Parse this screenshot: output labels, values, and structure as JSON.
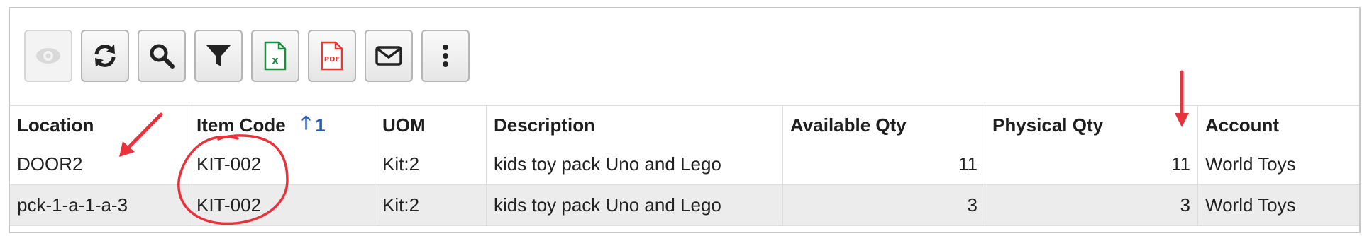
{
  "toolbar": {
    "buttons": [
      {
        "icon": "eye-icon",
        "enabled": false
      },
      {
        "icon": "refresh-icon",
        "enabled": true
      },
      {
        "icon": "search-icon",
        "enabled": true
      },
      {
        "icon": "filter-icon",
        "enabled": true
      },
      {
        "icon": "excel-export-icon",
        "enabled": true
      },
      {
        "icon": "pdf-export-icon",
        "enabled": true
      },
      {
        "icon": "email-icon",
        "enabled": true
      },
      {
        "icon": "more-options-icon",
        "enabled": true
      }
    ]
  },
  "grid": {
    "columns": {
      "location": "Location",
      "item_code": "Item Code",
      "uom": "UOM",
      "description": "Description",
      "available_qty": "Available Qty",
      "physical_qty": "Physical Qty",
      "account": "Account"
    },
    "sort": {
      "column": "Item Code",
      "direction": "ascending",
      "order": "1"
    },
    "rows": [
      {
        "location": "DOOR2",
        "item_code": "KIT-002",
        "uom": "Kit:2",
        "description": "kids toy pack Uno and Lego",
        "available_qty": "11",
        "physical_qty": "11",
        "account": "World Toys"
      },
      {
        "location": "pck-1-a-1-a-3",
        "item_code": "KIT-002",
        "uom": "Kit:2",
        "description": "kids toy pack Uno and Lego",
        "available_qty": "3",
        "physical_qty": "3",
        "account": "World Toys"
      }
    ]
  },
  "colors": {
    "annotation": "#e8323c",
    "sort_indicator": "#2a5db0",
    "alt_row": "#ececec",
    "excel_green": "#1e8e3e",
    "pdf_red": "#e53935"
  }
}
